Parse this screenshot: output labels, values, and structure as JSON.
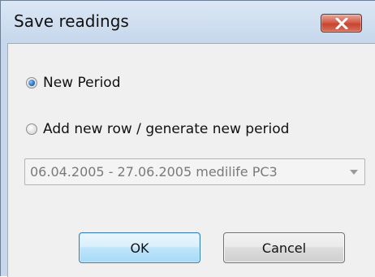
{
  "window": {
    "title": "Save readings"
  },
  "options": {
    "new_period": {
      "label": "New Period",
      "checked": true
    },
    "add_new_row": {
      "label": "Add new row / generate new period",
      "checked": false
    }
  },
  "period_select": {
    "selected_value": "06.04.2005 - 27.06.2005 medilife PC3",
    "enabled": false
  },
  "buttons": {
    "ok_label": "OK",
    "cancel_label": "Cancel"
  },
  "icons": {
    "close": "close-icon",
    "dropdown": "chevron-down-icon"
  },
  "colors": {
    "title_bar": "#c7d8ec",
    "close_button": "#c8442f",
    "dialog_body": "#f0f0f0",
    "default_button_border": "#3c7fb1"
  }
}
